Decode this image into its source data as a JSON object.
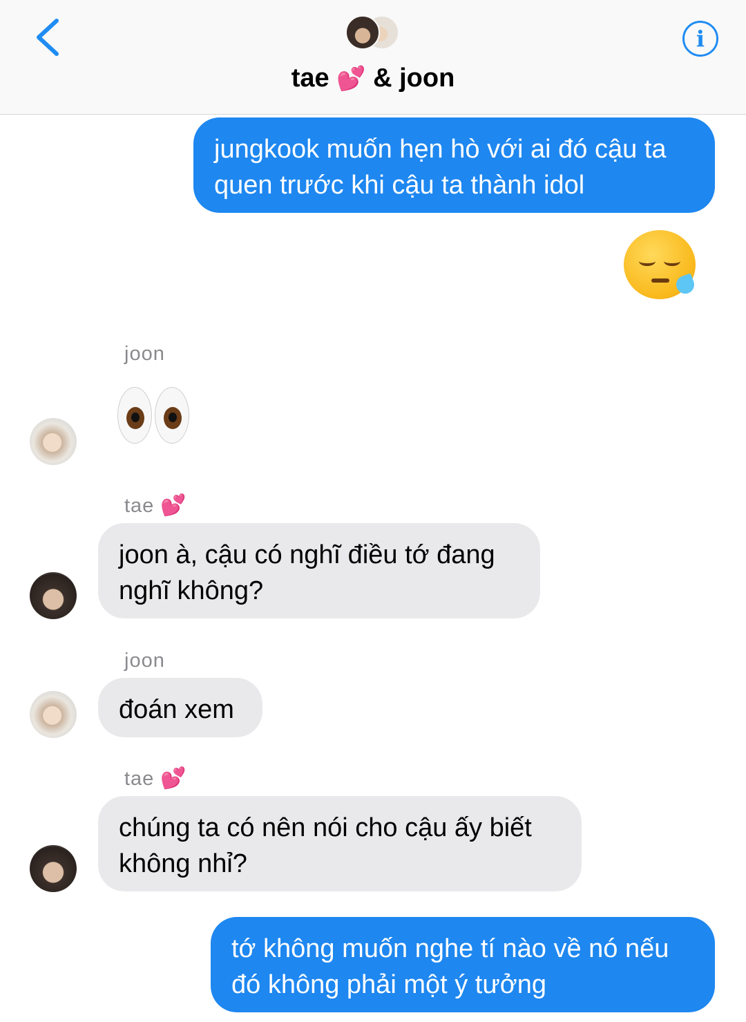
{
  "header": {
    "title_name1": "tae",
    "title_heart": "💕",
    "title_rest": "& joon",
    "info_label": "i"
  },
  "messages": [
    {
      "kind": "out",
      "text": "jungkook muốn hẹn hò với ai đó cậu ta quen trước khi cậu ta thành idol"
    },
    {
      "kind": "out-emoji",
      "emoji": "sleepy-face-emoji"
    },
    {
      "kind": "in-emoji",
      "sender": "joon",
      "emoji": "eyes-emoji"
    },
    {
      "kind": "in",
      "sender": "tae",
      "sender_heart": "💕",
      "text": "joon à, cậu có nghĩ điều tớ đang nghĩ không?"
    },
    {
      "kind": "in",
      "sender": "joon",
      "text": "đoán xem"
    },
    {
      "kind": "in",
      "sender": "tae",
      "sender_heart": "💕",
      "text": "chúng ta có nên nói cho cậu ấy biết không nhỉ?"
    },
    {
      "kind": "out",
      "text": "tớ không muốn nghe tí nào về nó nếu đó không phải một ý tưởng"
    }
  ],
  "colors": {
    "outgoing_bubble": "#1e87f0",
    "incoming_bubble": "#e9e9eb",
    "accent": "#1f8cf2"
  }
}
